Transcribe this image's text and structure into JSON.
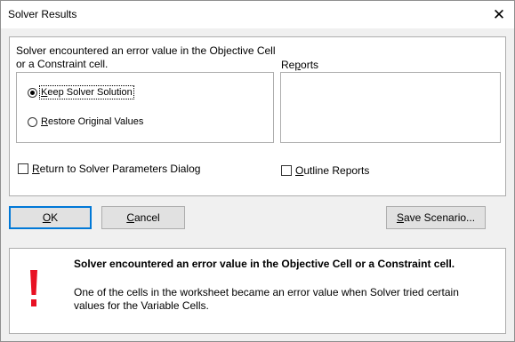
{
  "window": {
    "title": "Solver Results"
  },
  "message": {
    "line1": "Solver encountered an error value in the Objective Cell",
    "line2": "or a Constraint cell."
  },
  "options": {
    "keep_prefix": "K",
    "keep_rest": "eep Solver Solution",
    "restore_prefix": "R",
    "restore_rest": "estore Original Values",
    "selected": "keep"
  },
  "reports": {
    "label_prefix": "Re",
    "label_ul": "p",
    "label_rest": "orts",
    "items": []
  },
  "checkboxes": {
    "return_ul": "R",
    "return_rest": "eturn to Solver Parameters Dialog",
    "outline_ul": "O",
    "outline_rest": "utline Reports"
  },
  "buttons": {
    "ok_ul": "O",
    "ok_rest": "K",
    "cancel_ul": "C",
    "cancel_rest": "ancel",
    "save_ul": "S",
    "save_rest": "ave Scenario..."
  },
  "info": {
    "heading": "Solver encountered an error value in the Objective Cell or a Constraint cell.",
    "body": "One of the cells in the worksheet became an error value when Solver tried certain values for the Variable Cells.",
    "icon": "exclamation-icon",
    "icon_color": "#e81123"
  },
  "colors": {
    "accent": "#0078d7",
    "dialog_bg": "#f0f0f0"
  }
}
